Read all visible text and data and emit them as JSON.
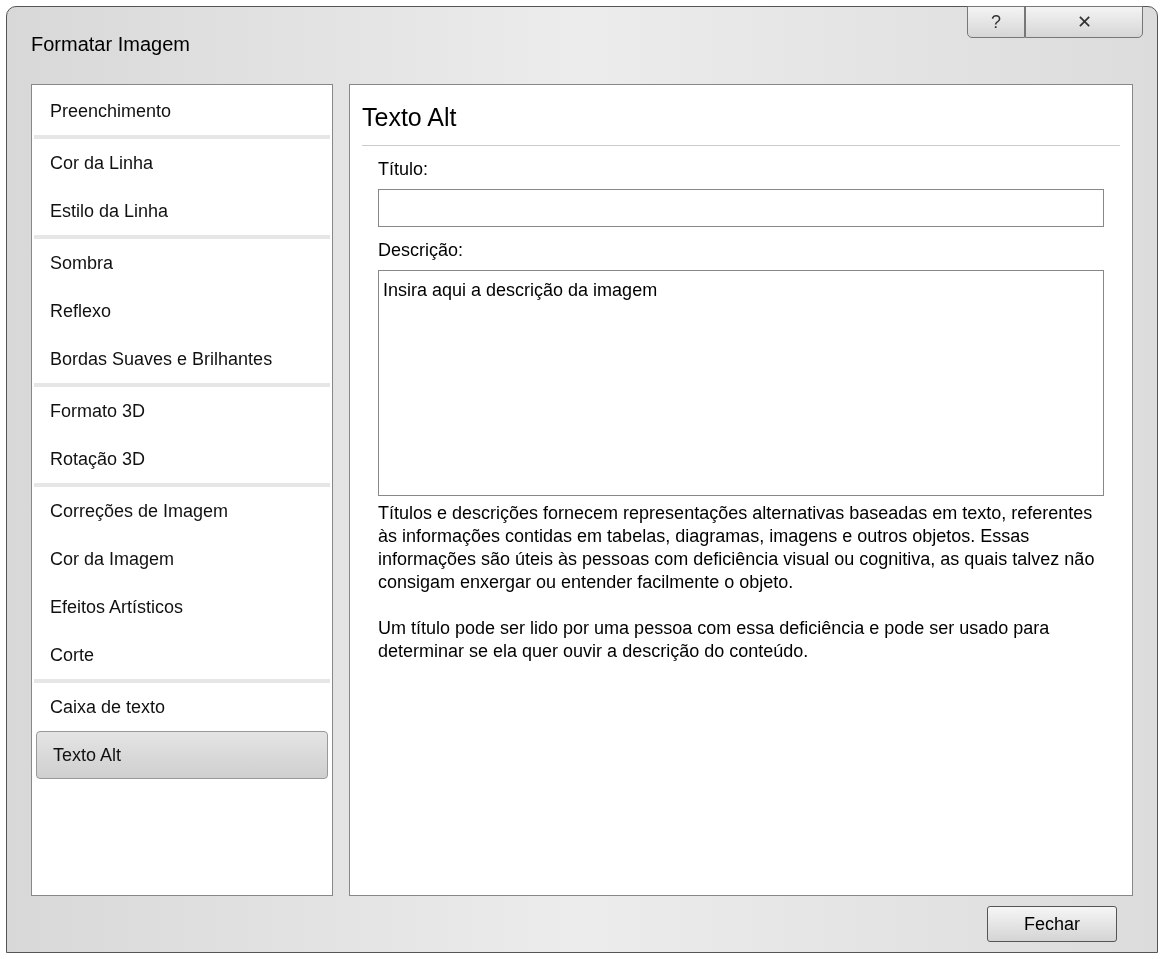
{
  "window": {
    "title": "Formatar Imagem",
    "controls": [
      "?",
      "✕"
    ]
  },
  "sidebar": {
    "groups": [
      {
        "items": [
          {
            "label": "Preenchimento",
            "selected": false
          }
        ]
      },
      {
        "items": [
          {
            "label": "Cor da Linha",
            "selected": false
          },
          {
            "label": "Estilo da Linha",
            "selected": false
          }
        ]
      },
      {
        "items": [
          {
            "label": "Sombra",
            "selected": false
          },
          {
            "label": "Reflexo",
            "selected": false
          },
          {
            "label": "Bordas Suaves e Brilhantes",
            "selected": false
          }
        ]
      },
      {
        "items": [
          {
            "label": "Formato 3D",
            "selected": false
          },
          {
            "label": "Rotação 3D",
            "selected": false
          }
        ]
      },
      {
        "items": [
          {
            "label": "Correções de Imagem",
            "selected": false
          },
          {
            "label": "Cor da Imagem",
            "selected": false
          },
          {
            "label": "Efeitos Artísticos",
            "selected": false
          },
          {
            "label": "Corte",
            "selected": false
          }
        ]
      },
      {
        "items": [
          {
            "label": "Caixa de texto",
            "selected": false
          },
          {
            "label": "Texto Alt",
            "selected": true
          }
        ]
      }
    ]
  },
  "panel": {
    "heading": "Texto Alt",
    "title_field": {
      "label": "Título:"
    },
    "description_field": {
      "label": "Descrição:",
      "value": "Insira aqui a descrição da imagem"
    },
    "paragraphs": [
      "Títulos e descrições fornecem representações alternativas baseadas em texto, referentes às informações contidas em tabelas, diagramas, imagens e outros objetos. Essas informações são úteis às pessoas com deficiência visual ou cognitiva, as quais talvez não consigam enxergar ou entender facilmente o objeto.",
      "Um título pode ser lido por uma pessoa com essa deficiência e pode ser usado para determinar se ela quer ouvir a descrição do conteúdo."
    ]
  },
  "buttons": [
    "Fechar"
  ]
}
